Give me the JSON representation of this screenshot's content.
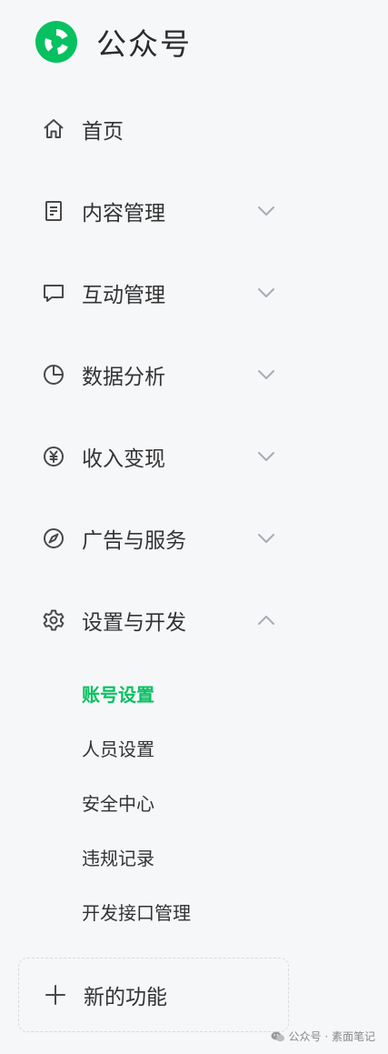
{
  "app": {
    "brand": "公众号"
  },
  "nav": {
    "items": [
      {
        "label": "首页",
        "icon": "home-icon",
        "chevron": "none"
      },
      {
        "label": "内容管理",
        "icon": "document-icon",
        "chevron": "down"
      },
      {
        "label": "互动管理",
        "icon": "chat-bubble-icon",
        "chevron": "down"
      },
      {
        "label": "数据分析",
        "icon": "pie-chart-icon",
        "chevron": "down"
      },
      {
        "label": "收入变现",
        "icon": "yen-coin-icon",
        "chevron": "down"
      },
      {
        "label": "广告与服务",
        "icon": "compass-icon",
        "chevron": "down"
      },
      {
        "label": "设置与开发",
        "icon": "gear-icon",
        "chevron": "up"
      }
    ],
    "sub_items": [
      {
        "label": "账号设置",
        "active": true
      },
      {
        "label": "人员设置",
        "active": false
      },
      {
        "label": "安全中心",
        "active": false
      },
      {
        "label": "违规记录",
        "active": false
      },
      {
        "label": "开发接口管理",
        "active": false
      }
    ],
    "new_function": {
      "label": "新的功能",
      "icon": "plus-icon"
    }
  },
  "watermark": {
    "text": "公众号 · 素面笔记",
    "icon": "wechat-icon"
  },
  "colors": {
    "accent": "#07c160",
    "background": "#f6f7f9",
    "text": "#333333",
    "icon": "#4a4a4a",
    "chevron": "#a8acb3"
  }
}
